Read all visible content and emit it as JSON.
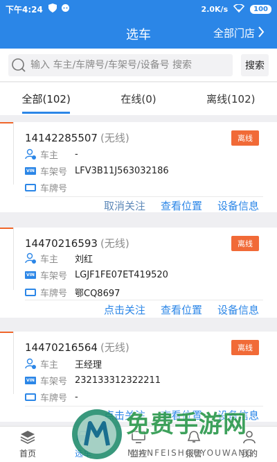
{
  "status_bar": {
    "time": "下午4:24",
    "speed": "2.0K/s",
    "battery": "100"
  },
  "header": {
    "title": "选车",
    "all_stores": "全部门店"
  },
  "search": {
    "placeholder": "输入 车主/车牌号/车架号/设备号 搜索",
    "button": "搜索"
  },
  "tabs": [
    {
      "label": "全部(102)",
      "active": true
    },
    {
      "label": "在线(0)",
      "active": false
    },
    {
      "label": "离线(102)",
      "active": false
    }
  ],
  "labels": {
    "owner": "车主",
    "vin": "车架号",
    "plate": "车牌号",
    "vin_icon": "VIN"
  },
  "cards": [
    {
      "device": "14142285507",
      "status": "(无线)",
      "badge": "离线",
      "owner": "-",
      "vin": "LFV3B11J563032186",
      "plate": "",
      "actions": [
        "取消关注",
        "查看位置",
        "设备信息"
      ]
    },
    {
      "device": "14470216593",
      "status": "(无线)",
      "badge": "离线",
      "owner": "刘红",
      "vin": "LGJF1FE07ET419520",
      "plate": "鄂CQ8697",
      "actions": [
        "点击关注",
        "查看位置",
        "设备信息"
      ]
    },
    {
      "device": "14470216564",
      "status": "(无线)",
      "badge": "离线",
      "owner": "王经理",
      "vin": "232133312322211",
      "plate": "-",
      "actions": [
        "点击关注",
        "查看位置",
        "设备信息"
      ]
    }
  ],
  "bottom_nav": [
    {
      "label": "首页",
      "icon": "layers-icon"
    },
    {
      "label": "选车",
      "icon": "car-icon"
    },
    {
      "label": "监控",
      "icon": "monitor-icon"
    },
    {
      "label": "报警",
      "icon": "alarm-icon"
    },
    {
      "label": "我的",
      "icon": "user-icon"
    }
  ],
  "watermark": {
    "text": "免费手游网",
    "sub": "MIANFEISHOUYOUWANG"
  },
  "colors": {
    "primary": "#2b86e7",
    "offline_badge": "#f16a37",
    "watermark_green": "#2e9a4f"
  }
}
